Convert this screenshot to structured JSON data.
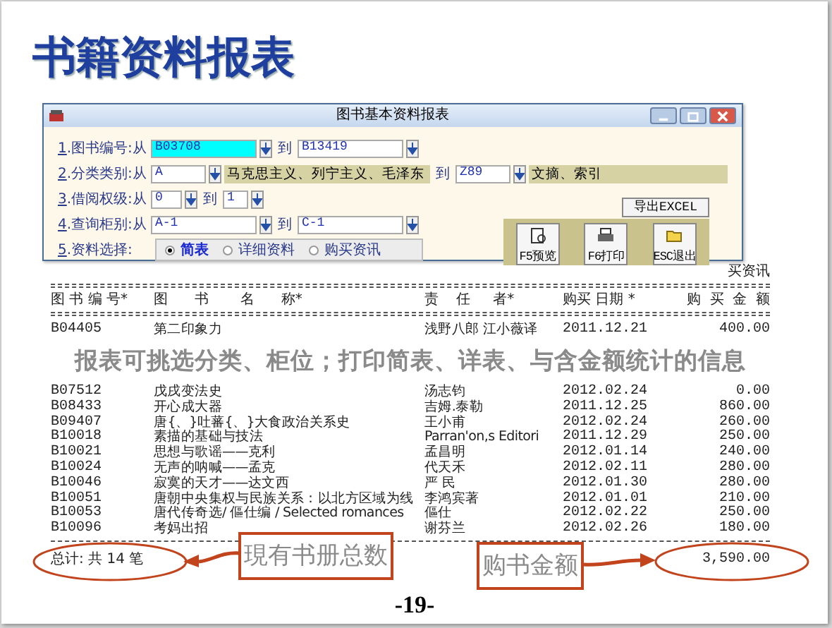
{
  "slide_title": "书籍资料报表",
  "dialog": {
    "title": "图书基本资料报表",
    "fields": [
      {
        "kind": "range",
        "number": "1",
        "label": ".图书编号:从",
        "from": "B03708",
        "from_focused": true,
        "to_label": "到",
        "to": "B13419"
      },
      {
        "kind": "range_desc",
        "number": "2",
        "label": ".分类类别:从",
        "from": "A",
        "from_desc": "马克思主义、列宁主义、毛泽东",
        "to_label": "到",
        "to": "Z89",
        "to_desc": "文摘、索引"
      },
      {
        "kind": "range_short",
        "number": "3",
        "label": ".借阅权级:从",
        "from": "0",
        "to_label": "到",
        "to": "1"
      },
      {
        "kind": "range",
        "number": "4",
        "label": ".查询柜别:从",
        "from": "A-1",
        "from_focused": false,
        "to_label": "到",
        "to": "C-1"
      },
      {
        "kind": "radio",
        "number": "5",
        "label": ".资料选择:",
        "options": [
          {
            "label": "简表",
            "selected": true
          },
          {
            "label": "详细资料",
            "selected": false
          },
          {
            "label": "购买资讯",
            "selected": false
          }
        ]
      }
    ],
    "export_button": "导出EXCEL",
    "toolbar_buttons": [
      {
        "kind": "preview",
        "label": "F5预览"
      },
      {
        "kind": "print",
        "label": "F6打印"
      },
      {
        "kind": "exit",
        "label": "ESC退出"
      }
    ]
  },
  "report": {
    "cut_heading": "买资讯",
    "columns": [
      "图 书 编 号*",
      "图      书       名      称*",
      "责    任     者*",
      "购买 日期 *",
      "购  买  金  额"
    ],
    "rows": [
      [
        "B04405",
        "第二印象力",
        "浅野八郎 江小薇译",
        "2011.12.21",
        "400.00"
      ]
    ],
    "caption": "报表可挑选分类、柜位；打印简表、详表、与含金额统计的信息",
    "rows_after": [
      [
        "B07512",
        "戊戌变法史",
        "汤志钧",
        "2012.02.24",
        "0.00"
      ],
      [
        "B08433",
        "开心成大器",
        "吉姆.泰勒",
        "2011.12.25",
        "860.00"
      ],
      [
        "B09407",
        "唐{、}吐蕃{、}大食政治关系史",
        "王小甫",
        "2012.02.24",
        "260.00"
      ],
      [
        "B10018",
        "素描的基础与技法",
        "Parran'on,s Editori",
        "2011.12.29",
        "250.00"
      ],
      [
        "B10021",
        "思想与歌谣——克利",
        "孟昌明",
        "2012.01.14",
        "240.00"
      ],
      [
        "B10024",
        "无声的呐喊——孟克",
        "代天禾",
        "2012.02.11",
        "280.00"
      ],
      [
        "B10046",
        "寂寞的天才——达文西",
        "严 民",
        "2012.01.30",
        "280.00"
      ],
      [
        "B10051",
        "唐朝中央集权与民族关系：以北方区域为线",
        "李鸿宾著",
        "2012.01.01",
        "210.00"
      ],
      [
        "B10053",
        "唐代传奇选/ 傴仕编 / Selected romances",
        "傴仕",
        "2012.02.22",
        "250.00"
      ],
      [
        "B10096",
        "考妈出招",
        "谢芬兰",
        "2012.02.26",
        "180.00"
      ]
    ],
    "total_label": "总计: 共 14 笔",
    "total_amount": "3,590.00"
  },
  "callouts": [
    "現有书册总数",
    "购书金额"
  ],
  "page_number": "-19-"
}
